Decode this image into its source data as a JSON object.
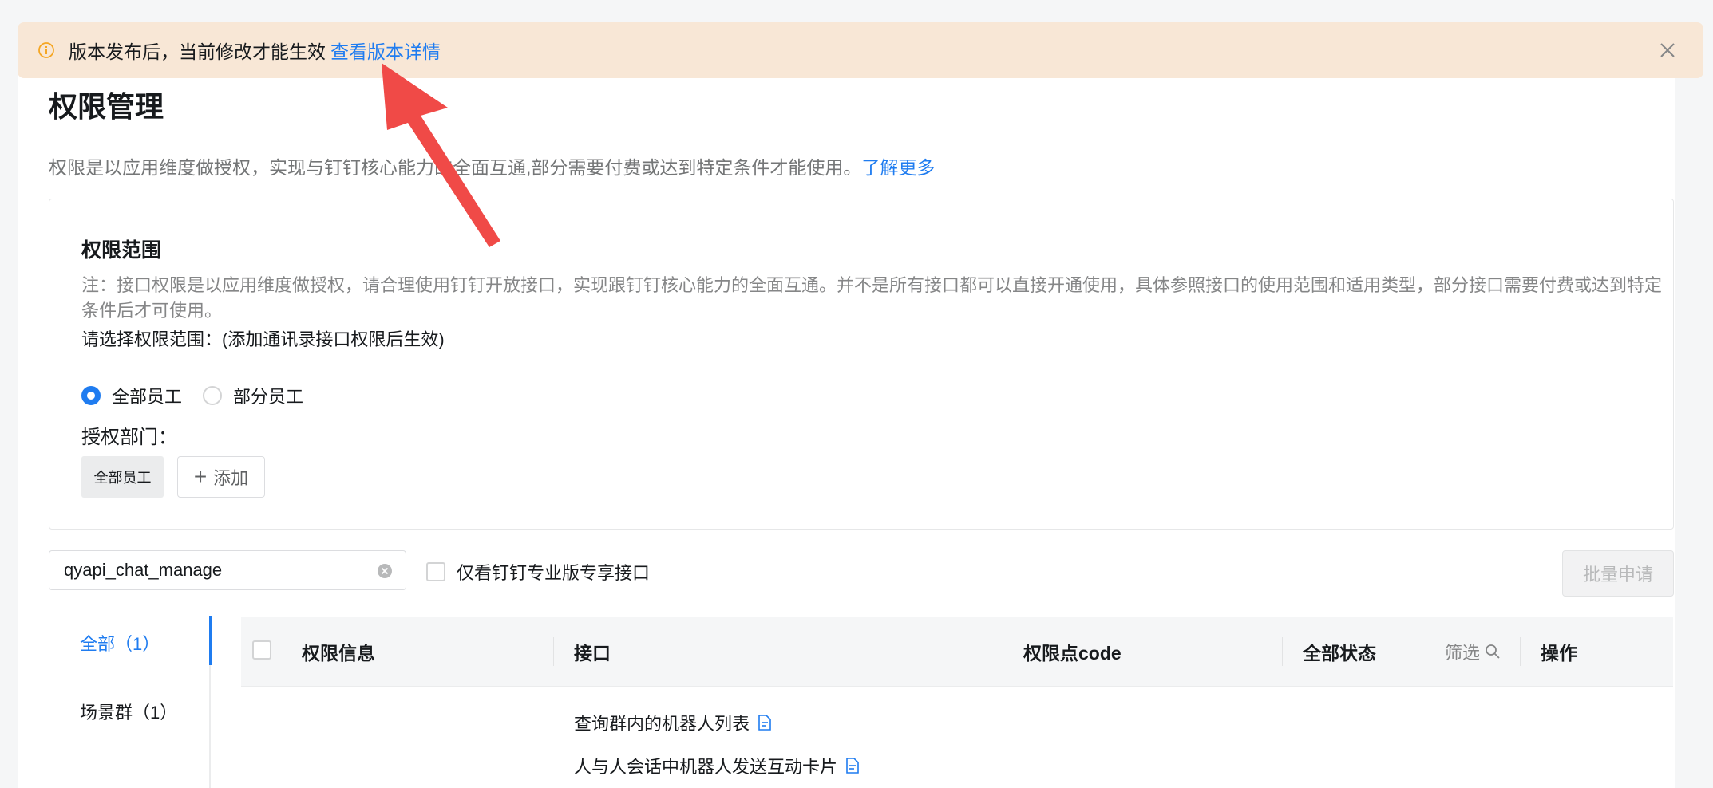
{
  "banner": {
    "message": "版本发布后，当前修改才能生效",
    "link": "查看版本详情"
  },
  "page": {
    "title": "权限管理",
    "description": "权限是以应用维度做授权，实现与钉钉核心能力的全面互通,部分需要付费或达到特定条件才能使用。",
    "learn_more": "了解更多"
  },
  "scope": {
    "title": "权限范围",
    "note": "注：接口权限是以应用维度做授权，请合理使用钉钉开放接口，实现跟钉钉核心能力的全面互通。并不是所有接口都可以直接开通使用，具体参照接口的使用范围和适用类型，部分接口需要付费或达到特定条件后才可使用。",
    "select_label": "请选择权限范围：(添加通讯录接口权限后生效)",
    "radio_all": "全部员工",
    "radio_part": "部分员工",
    "dept_label": "授权部门：",
    "tag": "全部员工",
    "add": "添加"
  },
  "filter_bar": {
    "search_value": "qyapi_chat_manage",
    "pro_only": "仅看钉钉专业版专享接口",
    "batch_apply": "批量申请"
  },
  "side_nav": {
    "items": [
      {
        "label": "全部（1）"
      },
      {
        "label": "场景群（1）"
      }
    ]
  },
  "table": {
    "headers": {
      "info": "权限信息",
      "api": "接口",
      "code": "权限点code",
      "status": "全部状态",
      "filter": "筛选",
      "action": "操作"
    },
    "apis": [
      {
        "label": "查询群内的机器人列表"
      },
      {
        "label": "人与人会话中机器人发送互动卡片"
      }
    ]
  },
  "colors": {
    "accent": "#1f7cf0",
    "banner_bg": "#f8e7d6",
    "arrow": "#f04a47"
  }
}
